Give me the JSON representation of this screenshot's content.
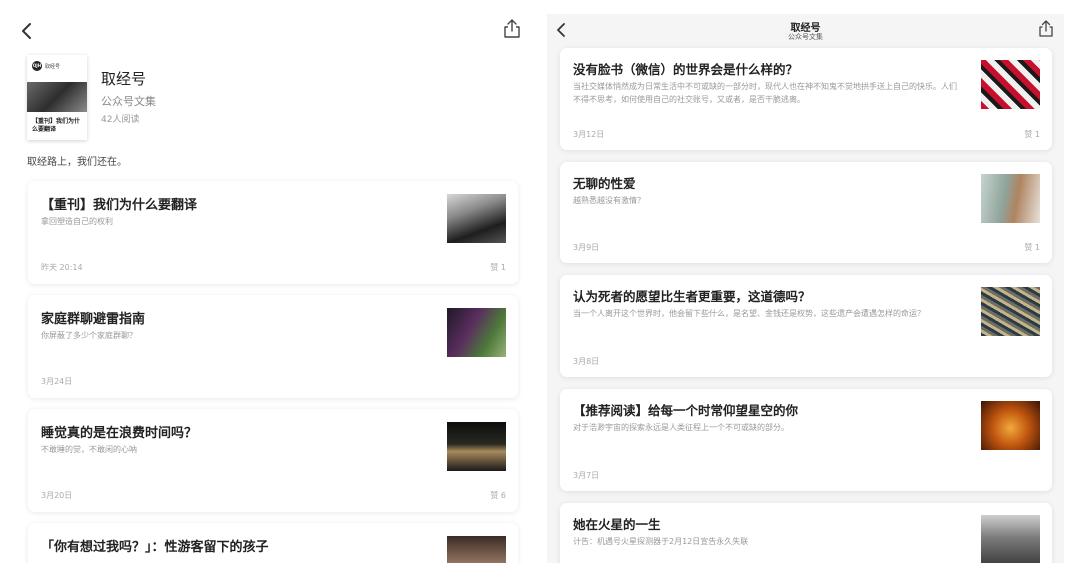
{
  "left": {
    "title": "取经号",
    "subtitle": "公众号文集",
    "reads": "42人阅读",
    "description": "取经路上，我们还在。",
    "cover": {
      "brand": "取经号",
      "logo": "QJH",
      "text": "【重刊】我们为什么要翻译"
    },
    "articles": [
      {
        "title": "【重刊】我们为什么要翻译",
        "summary": "拿回塑造自己的权利",
        "date": "昨天 20:14",
        "likes": "赞 1"
      },
      {
        "title": "家庭群聊避雷指南",
        "summary": "你屏蔽了多少个家庭群聊？",
        "date": "3月24日",
        "likes": ""
      },
      {
        "title": "睡觉真的是在浪费时间吗？",
        "summary": "不敢睡的觉，不敢闲的心呐",
        "date": "3月20日",
        "likes": "赞 6"
      },
      {
        "title": "「你有想过我吗？」：性游客留下的孩子",
        "summary": "",
        "date": "",
        "likes": ""
      }
    ]
  },
  "right": {
    "title": "取经号",
    "subtitle": "公众号文集",
    "articles": [
      {
        "title": "没有脸书（微信）的世界会是什么样的？",
        "summary": "当社交媒体悄然成为日常生活中不可或缺的一部分时，现代人也在神不知鬼不觉地拱手送上自己的快乐。人们不得不思考，如何使用自己的社交账号，又或者，是否干脆逃离。",
        "date": "3月12日",
        "likes": "赞 1"
      },
      {
        "title": "无聊的性爱",
        "summary": "越熟悉越没有激情？",
        "date": "3月9日",
        "likes": "赞 1"
      },
      {
        "title": "认为死者的愿望比生者更重要，这道德吗？",
        "summary": "当一个人离开这个世界时，他会留下些什么，是名望、金钱还是权势，这些遗产会遭遇怎样的命运？",
        "date": "3月8日",
        "likes": ""
      },
      {
        "title": "【推荐阅读】给每一个时常仰望星空的你",
        "summary": "对于浩渺宇宙的探索永远是人类征程上一个不可或缺的部分。",
        "date": "3月7日",
        "likes": ""
      },
      {
        "title": "她在火星的一生",
        "summary": "计告：机遇号火星探测器于2月12日宣告永久失联",
        "date": "",
        "likes": ""
      }
    ]
  },
  "icons": {
    "back": "chevron-left-icon",
    "share": "share-icon"
  },
  "colors": {
    "background": "#ffffff",
    "list_background": "#f5f5f5",
    "title_text": "#222222",
    "muted_text": "#999999"
  }
}
